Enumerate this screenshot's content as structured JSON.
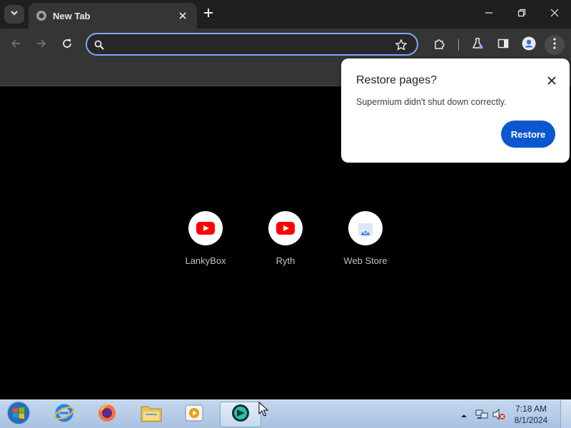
{
  "browser": {
    "tab": {
      "title": "New Tab"
    },
    "omnibox": {
      "value": "",
      "placeholder": ""
    }
  },
  "icons": {
    "tab_search": "chevron-down-icon",
    "tab_favicon": "globe-icon",
    "tab_close": "close-icon",
    "new_tab": "plus-icon",
    "back": "arrow-left-icon",
    "forward": "arrow-right-icon",
    "reload": "reload-icon",
    "search": "search-icon",
    "bookmark": "star-icon",
    "extensions": "puzzle-icon",
    "labs": "flask-icon",
    "side_panel": "side-panel-icon",
    "profile": "avatar-icon",
    "menu": "kebab-menu-icon"
  },
  "popup": {
    "title": "Restore pages?",
    "message": "Supermium didn't shut down correctly.",
    "button": "Restore"
  },
  "shortcuts": [
    {
      "label": "LankyBox",
      "icon": "youtube-icon"
    },
    {
      "label": "Ryth",
      "icon": "youtube-icon"
    },
    {
      "label": "Web Store",
      "icon": "web-store-icon"
    }
  ],
  "taskbar": {
    "time": "7:18 AM",
    "date": "8/1/2024",
    "apps": [
      "internet-explorer-icon",
      "firefox-icon",
      "file-explorer-icon",
      "media-player-icon",
      "supermium-icon"
    ]
  },
  "colors": {
    "accent": "#0b57d0",
    "omnibox_focus": "#7aa7ff",
    "toolbar": "#353535",
    "tabstrip": "#1f1f1f",
    "youtube_red": "#ff0000"
  }
}
